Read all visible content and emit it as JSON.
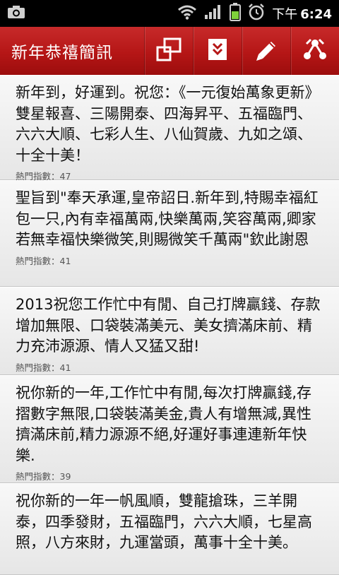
{
  "status_bar": {
    "time_prefix": "下午",
    "time": "6:24"
  },
  "action_bar": {
    "title": "新年恭禧簡訊",
    "actions": [
      "switch-window-icon",
      "download-icon",
      "edit-icon",
      "share-icon"
    ]
  },
  "colors": {
    "action_bar": "#b51616",
    "status_bar": "#000000",
    "list_bg": "#ececec"
  },
  "messages": [
    {
      "text": "新年到，好運到。祝您：《一元復始萬象更新》雙星報喜、三陽開泰、四海昇平、五福臨門、六六大順、七彩人生、八仙賀歲、九如之頌、十全十美！",
      "hot": "熱門指數：47"
    },
    {
      "text": "聖旨到\"奉天承運,皇帝詔日.新年到,特賜幸福紅包一只,內有幸福萬兩,快樂萬兩,笑容萬兩,卿家若無幸福快樂微笑,則賜微笑千萬兩\"欽此謝恩",
      "hot": "熱門指數：41"
    },
    {
      "text": "2013祝您工作忙中有閒、自己打牌贏錢、存款增加無限、口袋裝滿美元、美女擠滿床前、精力充沛源源、情人又猛又甜!",
      "hot": "熱門指數：41"
    },
    {
      "text": "祝你新的一年,工作忙中有閒,每次打牌贏錢,存摺數字無限,口袋裝滿美金,貴人有增無減,異性擠滿床前,精力源源不絕,好運好事連連新年快樂.",
      "hot": "熱門指數：39"
    },
    {
      "text": "祝你新的一年一帆風順，雙龍搶珠，三羊開泰，四季發財，五福臨門，六六大順，七星高照，八方來財，九運當頭，萬事十全十美。",
      "hot": ""
    }
  ]
}
